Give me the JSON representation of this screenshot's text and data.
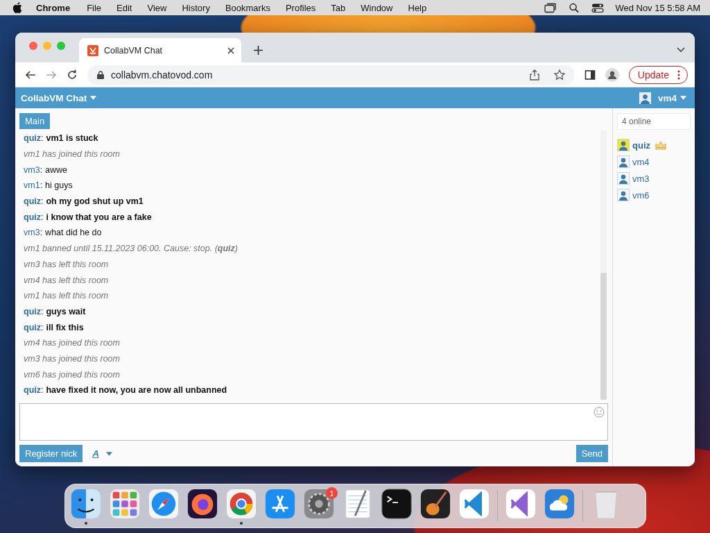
{
  "menubar": {
    "app": "Chrome",
    "menus": [
      "File",
      "Edit",
      "View",
      "History",
      "Bookmarks",
      "Profiles",
      "Tab",
      "Window",
      "Help"
    ],
    "clock": "Wed Nov 15  5:58 AM"
  },
  "browser": {
    "tab_title": "CollabVM Chat",
    "url": "collabvm.chatovod.com",
    "update_button": "Update"
  },
  "chat": {
    "title": "CollabVM Chat",
    "user": "vm4",
    "room_tab": "Main",
    "messages": [
      {
        "kind": "chat",
        "author": "quiz",
        "separator": ":",
        "text": "vm1 is stuck",
        "emphasis": true
      },
      {
        "kind": "system",
        "text": "vm1 has joined this room"
      },
      {
        "kind": "chat",
        "author": "vm3",
        "separator": ":",
        "text": "awwe",
        "emphasis": false
      },
      {
        "kind": "chat",
        "author": "vm1",
        "separator": ":",
        "text": "hi guys",
        "emphasis": false
      },
      {
        "kind": "chat",
        "author": "quiz",
        "separator": ":",
        "text": "oh my god shut up vm1",
        "emphasis": true
      },
      {
        "kind": "chat",
        "author": "quiz",
        "separator": ":",
        "text": "i know that you are a fake",
        "emphasis": true
      },
      {
        "kind": "chat",
        "author": "vm3",
        "separator": ":",
        "text": "what did he do",
        "emphasis": false
      },
      {
        "kind": "system",
        "text": "vm1 banned until 15.11.2023 06:00. Cause: stop. (**quiz**)"
      },
      {
        "kind": "system",
        "text": "vm3 has left this room"
      },
      {
        "kind": "system",
        "text": "vm4 has left this room"
      },
      {
        "kind": "system",
        "text": "vm1 has left this room"
      },
      {
        "kind": "chat",
        "author": "quiz",
        "separator": ":",
        "text": "guys wait",
        "emphasis": true
      },
      {
        "kind": "chat",
        "author": "quiz",
        "separator": ":",
        "text": "ill fix this",
        "emphasis": true
      },
      {
        "kind": "system",
        "text": "vm4 has joined this room"
      },
      {
        "kind": "system",
        "text": "vm3 has joined this room"
      },
      {
        "kind": "system",
        "text": "vm6 has joined this room"
      },
      {
        "kind": "chat",
        "author": "quiz",
        "separator": ":",
        "text": "have fixed it now, you are now all unbanned",
        "emphasis": true
      }
    ],
    "register_button": "Register nick",
    "format_button": "A",
    "send_button": "Send",
    "online_count": "4 online",
    "users": [
      {
        "name": "quiz",
        "owner": true
      },
      {
        "name": "vm4",
        "owner": false
      },
      {
        "name": "vm3",
        "owner": false
      },
      {
        "name": "vm6",
        "owner": false
      }
    ]
  },
  "dock": [
    {
      "kind": "finder",
      "running": true
    },
    {
      "kind": "launchpad",
      "running": false
    },
    {
      "kind": "safari",
      "running": false
    },
    {
      "kind": "firefox",
      "running": false
    },
    {
      "kind": "chrome",
      "running": true
    },
    {
      "kind": "appstore",
      "running": false
    },
    {
      "kind": "settings",
      "running": false,
      "badge": "1"
    },
    {
      "kind": "textedit",
      "running": false
    },
    {
      "kind": "terminal",
      "running": false
    },
    {
      "kind": "garageband",
      "running": false
    },
    {
      "kind": "vscode",
      "running": false
    },
    {
      "kind": "divider"
    },
    {
      "kind": "visualstudio",
      "running": false
    },
    {
      "kind": "weather",
      "running": false
    },
    {
      "kind": "divider"
    },
    {
      "kind": "trash",
      "running": false
    }
  ]
}
